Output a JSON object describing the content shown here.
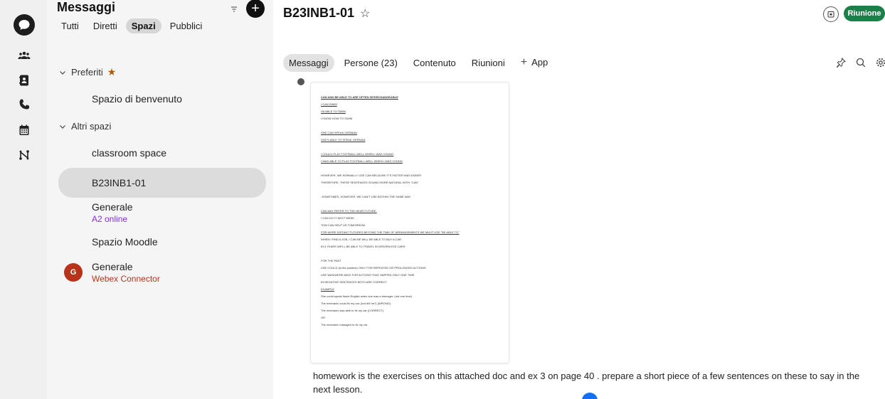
{
  "sidebar": {
    "title": "Messaggi",
    "tabs": [
      {
        "label": "Tutti"
      },
      {
        "label": "Diretti"
      },
      {
        "label": "Spazi"
      },
      {
        "label": "Pubblici"
      }
    ],
    "favorites_label": "Preferiti",
    "other_label": "Altri spazi",
    "items": [
      {
        "name": "Spazio di benvenuto"
      },
      {
        "name": "classroom space"
      },
      {
        "name": "B23INB1-01"
      },
      {
        "name": "Generale",
        "sub": "A2 online"
      },
      {
        "name": "Spazio Moodle"
      },
      {
        "name": "Generale",
        "sub": "Webex Connector",
        "avatar": "G"
      }
    ]
  },
  "header": {
    "title": "B23INB1-01",
    "meeting_label": "Riunione"
  },
  "tabs": [
    {
      "label": "Messaggi"
    },
    {
      "label": "Persone (23)"
    },
    {
      "label": "Contenuto"
    },
    {
      "label": "Riunioni"
    },
    {
      "label": "App"
    }
  ],
  "document": {
    "lines": [
      {
        "t": "CAN AND BE ABLE TO ARE OFTEN INTERCHANGEABLE",
        "s": "ub"
      },
      {
        "t": "I CAN SWIM",
        "s": "u"
      },
      {
        "t": "I'M ABLE TO SWIM",
        "s": "u"
      },
      {
        "t": "I KNOW HOW TO SWIM",
        "s": ""
      },
      {
        "t": "",
        "s": "gap"
      },
      {
        "t": "SHE CAN SPEAK GERMAN",
        "s": "u"
      },
      {
        "t": "SHE'S ABLE TO SPEAK GERMAN",
        "s": "u"
      },
      {
        "t": "",
        "s": "gap"
      },
      {
        "t": "I COULD PLAY FOOTBALL WELL WHEN I WAS YOUNG",
        "s": "u"
      },
      {
        "t": "I WAS ABLE TO PLAY FOOTBALL WELL WHEN I WAS YOUNG",
        "s": "u"
      },
      {
        "t": "",
        "s": "gap"
      },
      {
        "t": "HOWEVER, WE NORMALLY USE CAN BECAUSE IT'S FASTER AND EASIER",
        "s": ""
      },
      {
        "t": "THEREFORE, THESE SENTENCES SOUND MORE NATURAL WITH \"CAN\"",
        "s": ""
      },
      {
        "t": "",
        "s": "gap"
      },
      {
        "t": "-SOMETIMES, HOWEVER, WE CAN'T USE BOTHIN THE SAME WAY",
        "s": ""
      },
      {
        "t": "",
        "s": "gap"
      },
      {
        "t": "CAN MAY REFER TO THE NEAR FUTURE.",
        "s": "u"
      },
      {
        "t": "I CAN DO IT NEXT WEEK",
        "s": ""
      },
      {
        "t": "TOM CAN HELP US TOMORROW.",
        "s": ""
      },
      {
        "t": "FOR MORE DISTANT FUTURES BEYOND THE TIME OF ARRANGEMENTS WE MUST USE \"BE ABLE TO\"",
        "s": "u"
      },
      {
        "t": "WHEN I FIND A JOB, I CAN BE WILL BE ABLE TO BUY A CAR.",
        "s": ""
      },
      {
        "t": "IN 5 YEARS WE'LL BE ABLE TO TRAVEL IN DRIVERLESS CARS",
        "s": ""
      },
      {
        "t": "",
        "s": "gap"
      },
      {
        "t": "FOR THE PAST",
        "s": ""
      },
      {
        "t": "USE COULD (in the positive) ONLY FOR REPEATED OR PROLONGED ACTIONS",
        "s": ""
      },
      {
        "t": "USE WAS/WERE ABLE FOR ACTIONS THAT HAPPEN ONLY ONE TIME",
        "s": ""
      },
      {
        "t": "IN NEGATIVE SENTENCES BOTH ARE CORRECT",
        "s": ""
      },
      {
        "t": "EXAMPLE",
        "s": "u"
      },
      {
        "t": "She could speak fluent English when she was a teenager. (not one time)",
        "s": ""
      },
      {
        "t": "The mechanic could fix my car. (but did he?) (WRONG)",
        "s": ""
      },
      {
        "t": "The mechanic was able to fix my car (CORRECT)",
        "s": ""
      },
      {
        "t": "OR",
        "s": ""
      },
      {
        "t": "The mechanic managed to fix my car",
        "s": ""
      }
    ]
  },
  "message": {
    "text": "homework is the exercises on this attached doc and ex 3 on page 40 . prepare a short piece of a few sentences on these to say in the next lesson."
  },
  "colors": {
    "accent_green": "#1a7f48",
    "favorite_star": "#b25a00",
    "sub_purple": "#8a2be2",
    "sub_red": "#b8331c",
    "avatar_red": "#b8331c"
  },
  "icons": {
    "rail": [
      "chat-bubble-icon",
      "teams-icon",
      "contacts-icon",
      "phone-icon",
      "calendar-icon",
      "workflow-icon"
    ]
  }
}
